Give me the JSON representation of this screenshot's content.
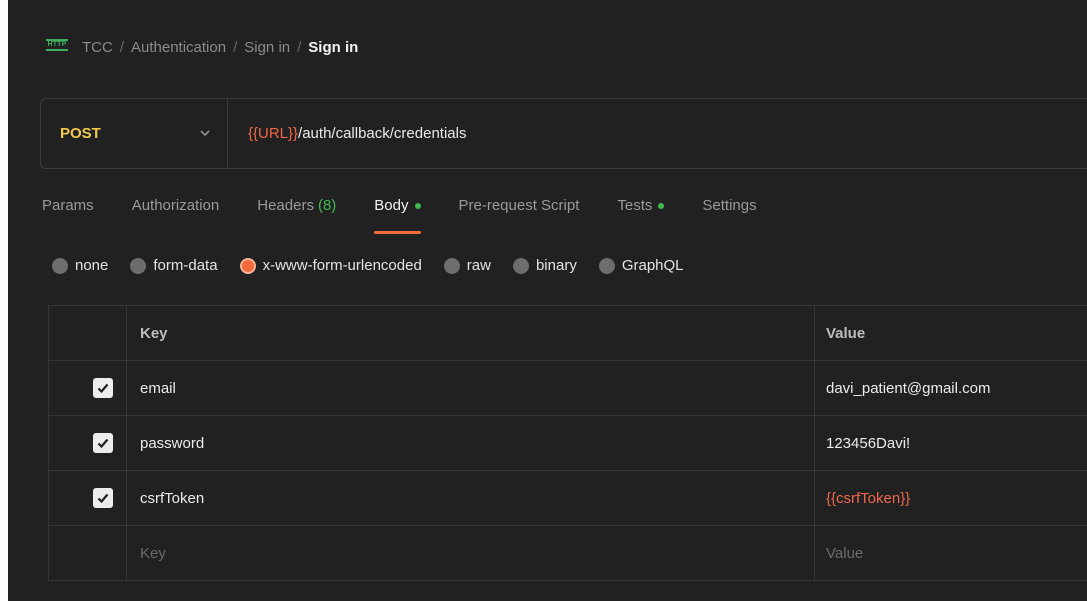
{
  "breadcrumb": {
    "icon": "http-icon",
    "items": [
      "TCC",
      "Authentication",
      "Sign in"
    ],
    "current": "Sign in",
    "separator": "/"
  },
  "request": {
    "method": "POST",
    "url_variable": "{{URL}}",
    "url_path": "/auth/callback/credentials"
  },
  "tabs": [
    {
      "label": "Params"
    },
    {
      "label": "Authorization"
    },
    {
      "label": "Headers",
      "count": "(8)"
    },
    {
      "label": "Body",
      "active": true,
      "indicator": true
    },
    {
      "label": "Pre-request Script"
    },
    {
      "label": "Tests",
      "indicator": true
    },
    {
      "label": "Settings"
    }
  ],
  "body_types": [
    {
      "label": "none"
    },
    {
      "label": "form-data"
    },
    {
      "label": "x-www-form-urlencoded",
      "selected": true
    },
    {
      "label": "raw"
    },
    {
      "label": "binary"
    },
    {
      "label": "GraphQL"
    }
  ],
  "table": {
    "headers": {
      "key": "Key",
      "value": "Value"
    },
    "rows": [
      {
        "key": "email",
        "value": "davi_patient@gmail.com",
        "checked": true
      },
      {
        "key": "password",
        "value": "123456Davi!",
        "checked": true
      },
      {
        "key": "csrfToken",
        "value": "{{csrfToken}}",
        "checked": true,
        "is_variable": true
      }
    ],
    "placeholder": {
      "key": "Key",
      "value": "Value"
    }
  },
  "colors": {
    "background": "#212121",
    "method": "#f2c94c",
    "variable": "#f0664a",
    "accent": "#f26b3a",
    "indicator": "#3fb950"
  }
}
